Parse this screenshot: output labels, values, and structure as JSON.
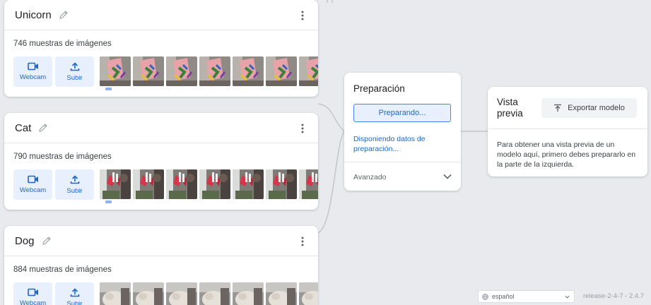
{
  "classes": [
    {
      "name": "Unicorn",
      "sample_count": "746 muestras de imágenes",
      "webcam_label": "Webcam",
      "upload_label": "Subir",
      "thumb_theme": "unicorn"
    },
    {
      "name": "Cat",
      "sample_count": "790 muestras de imágenes",
      "webcam_label": "Webcam",
      "upload_label": "Subir",
      "thumb_theme": "cat"
    },
    {
      "name": "Dog",
      "sample_count": "884 muestras de imágenes",
      "webcam_label": "Webcam",
      "upload_label": "Subir",
      "thumb_theme": "dog"
    }
  ],
  "training": {
    "title": "Preparación",
    "button_label": "Preparando...",
    "status_text": "Disponiendo datos de preparación...",
    "advanced_label": "Avanzado"
  },
  "preview": {
    "title": "Vista previa",
    "export_label": "Exportar modelo",
    "description": "Para obtener una vista previa de un modelo aquí, primero debes prepararlo en la parte de la izquierda."
  },
  "footer": {
    "language": "español",
    "release": "release-2-4-7 - 2.4.7"
  },
  "colors": {
    "accent": "#1967d2",
    "accent_bg": "#e8f0fe",
    "canvas": "#e8eaed"
  },
  "icons": {
    "edit": "pencil-icon",
    "more": "more-vert-icon",
    "webcam": "videocam-icon",
    "upload": "upload-icon",
    "export": "export-icon",
    "expand": "chevron-down-icon",
    "language": "globe-icon"
  }
}
